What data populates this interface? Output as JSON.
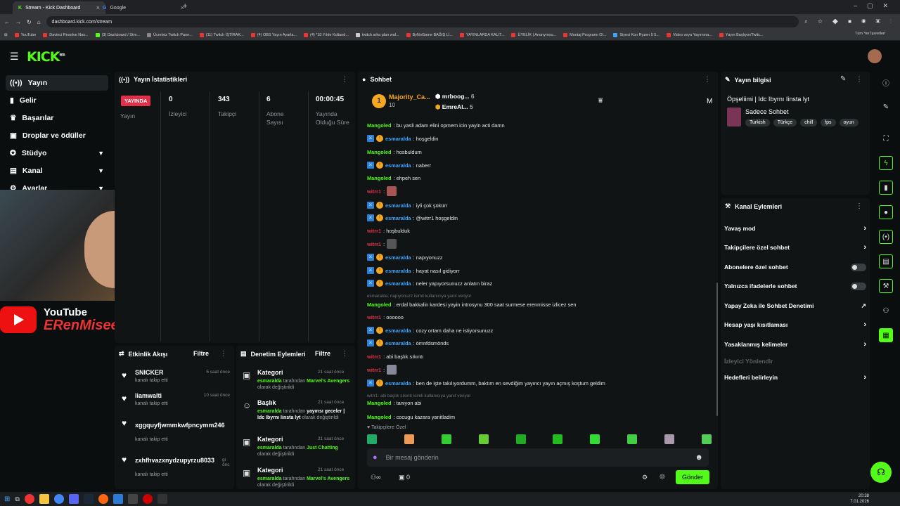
{
  "browser": {
    "tabs": [
      {
        "title": "Stream - Kick Dashboard",
        "active": true
      },
      {
        "title": "Google",
        "active": false
      }
    ],
    "url": "dashboard.kick.com/stream",
    "bookmarks": [
      "YouTube",
      "Davinci Resolve Nas...",
      "(3) Dashboard / Stre...",
      "Ücretsiz Twitch Pane...",
      "(11) Twitch İŞTİRAK...",
      "(4) OBS Yayın Ayarla...",
      "(4) *10 Yılde Kulland...",
      "twitch arka plan wal...",
      "ByNoGame BAĞIŞ Lİ...",
      "YAYINLARDA KALIT...",
      "ÜYELİK | Anonymou...",
      "Montaj Programı Ol...",
      "Siyesi Kısı Ryzen 5 5...",
      "Video veya Yayımına...",
      "Yayın Başlıyor/Twitc..."
    ],
    "all_bookmarks": "Tüm Yer İşaretleri"
  },
  "sidebar": {
    "items": [
      {
        "label": "Yayın",
        "icon": "broadcast-icon",
        "active": true
      },
      {
        "label": "Gelir",
        "icon": "revenue-icon"
      },
      {
        "label": "Başarılar",
        "icon": "trophy-icon"
      },
      {
        "label": "Droplar ve ödüller",
        "icon": "gift-icon"
      },
      {
        "label": "Stüdyo",
        "icon": "studio-icon",
        "expandable": true
      },
      {
        "label": "Kanal",
        "icon": "channel-icon",
        "expandable": true
      },
      {
        "label": "Ayarlar",
        "icon": "gear-icon",
        "expandable": true
      }
    ]
  },
  "webcam_overlay": {
    "brand": "YouTube",
    "channel": "ERenMisee"
  },
  "stats": {
    "title": "Yayın İstatistikleri",
    "live_badge": "YAYINDA",
    "stream_label": "Yayın",
    "viewers": {
      "value": "0",
      "label": "İzleyici"
    },
    "followers": {
      "value": "343",
      "label": "Takipçi"
    },
    "subs": {
      "value": "6",
      "label": "Abone Sayısı"
    },
    "duration": {
      "value": "00:00:45",
      "label": "Yayında Olduğu Süre"
    }
  },
  "activity": {
    "title": "Etkinlik Akışı",
    "filter": "Filtre",
    "items": [
      {
        "name": "SNICKER",
        "sub": "kanalı takip etti",
        "time": "5 saat önce"
      },
      {
        "name": "liamwalti",
        "sub": "kanalı takip etti",
        "time": "10 saat önce"
      },
      {
        "name": "xggquyfjwmmkwfpncymm246",
        "sub": "kanalı takip etti",
        "time": ""
      },
      {
        "name": "zxhfhvazxnydzupyrzu8033",
        "sub": "kanalı takip etti",
        "time": "gi önc"
      }
    ]
  },
  "moderation": {
    "title": "Denetim Eylemleri",
    "filter": "Filtre",
    "items": [
      {
        "title": "Kategori",
        "time": "21 saat önce",
        "user": "esmaralda",
        "mid": " tarafından ",
        "value": "Marvel's Avengers",
        "tail": " olarak değiştirildi"
      },
      {
        "title": "Başlık",
        "time": "21 saat önce",
        "user": "esmaralda",
        "mid": " tarafından ",
        "value_plain": "yayınsı geceler | Idc Ibyrnı Iinsta lyt",
        "tail": " olarak değiştirildi"
      },
      {
        "title": "Kategori",
        "time": "21 saat önce",
        "user": "esmaralda",
        "mid": " tarafından ",
        "value": "Just Chatting",
        "tail": " olarak değiştirildi"
      },
      {
        "title": "Kategori",
        "time": "21 saat önce",
        "user": "esmaralda",
        "mid": " tarafından ",
        "value": "Marvel's Avengers",
        "tail": " olarak değiştirildi"
      }
    ]
  },
  "chat": {
    "title": "Sohbet",
    "top_gifters": [
      {
        "name": "Majority_Ca...",
        "count": "10"
      },
      {
        "name": "mrboog...",
        "count": "6"
      },
      {
        "name": "EmreAl...",
        "count": "5"
      }
    ],
    "messages": [
      {
        "user": "Mangoled",
        "color": "g",
        "text": ": bu yasli adam elini opmem icin yayin acti damn"
      },
      {
        "user": "esmaralda",
        "color": "b",
        "badges": true,
        "text": ": hoşgeldin"
      },
      {
        "user": "Mangoled",
        "color": "g",
        "text": ": hosbuldum"
      },
      {
        "user": "esmaralda",
        "color": "b",
        "badges": true,
        "text": ": naberr"
      },
      {
        "user": "Mangoled",
        "color": "g",
        "text": ": ehpeh sen"
      },
      {
        "user": "witrr1",
        "color": "r",
        "text": ":",
        "emote": true
      },
      {
        "user": "esmaralda",
        "color": "b",
        "badges": true,
        "text": ": iyli çok şükürr"
      },
      {
        "user": "esmaralda",
        "color": "b",
        "badges": true,
        "text": ": @witrr1 hoşgeldin"
      },
      {
        "user": "witrr1",
        "color": "r",
        "text": ": hoşbulduk"
      },
      {
        "user": "witrr1",
        "color": "r",
        "text": ":",
        "emote": true
      },
      {
        "user": "esmaralda",
        "color": "b",
        "badges": true,
        "text": ": napıyonuzz"
      },
      {
        "user": "esmaralda",
        "color": "b",
        "badges": true,
        "text": ": hayat nasıl gidiyorr"
      },
      {
        "user": "esmaralda",
        "color": "b",
        "badges": true,
        "text": ": neler yapıyorsunuzz anlatın biraz"
      },
      {
        "reply": "esmaralda: napıyonuzz isimli kullanıcıya yanıt veriyor"
      },
      {
        "user": "Mangoled",
        "color": "g",
        "text": ": erdal bakkalin kardesi yayin introsynu 300 saat surmese erenmisse izlicez sen"
      },
      {
        "user": "witrr1",
        "color": "r",
        "text": ": oooooo"
      },
      {
        "user": "esmaralda",
        "color": "b",
        "badges": true,
        "text": ": cozy ortam daha ne istiyorsunuzz"
      },
      {
        "user": "esmaralda",
        "color": "b",
        "badges": true,
        "text": ": ömnfdsmönds"
      },
      {
        "user": "witrr1",
        "color": "r",
        "text": ": abi başlık sıkıntı"
      },
      {
        "user": "witrr1",
        "color": "r",
        "text": ":",
        "emote": true
      },
      {
        "user": "esmaralda",
        "color": "b",
        "badges": true,
        "text": ": ben de işte takılıyordumm, baktım en sevdiğim yayıncı yayın açmış koştum geldim"
      },
      {
        "reply": "witrr1: abi başlık sıkıntı isimli kullanıcıya yanıt veriyor"
      },
      {
        "user": "Mangoled",
        "color": "g",
        "text": ": taniyon abi"
      },
      {
        "user": "Mangoled",
        "color": "g",
        "text": ": cocugu kazara yanitladim"
      }
    ],
    "followers_only_label": "Takipçilere Özel",
    "input_placeholder": "Bir mesaj gönderin",
    "viewer_count": "0",
    "send_label": "Gönder"
  },
  "stream_info": {
    "title": "Yayın bilgisi",
    "stream_title": "Öpşeliimi | Idc Ibyrnı Iinsta lyt",
    "category": "Sadece Sohbet",
    "tags": [
      "Turkish",
      "Türkçe",
      "chill",
      "fps",
      "oyun"
    ]
  },
  "channel_actions": {
    "title": "Kanal Eylemleri",
    "items": [
      {
        "label": "Yavaş mod",
        "type": "arrow"
      },
      {
        "label": "Takipçilere özel sohbet",
        "type": "arrow"
      },
      {
        "label": "Abonelere özel sohbet",
        "type": "toggle"
      },
      {
        "label": "Yalnızca ifadelerle sohbet",
        "type": "toggle"
      },
      {
        "label": "Yapay Zeka ile Sohbet Denetimi",
        "type": "external"
      },
      {
        "label": "Hesap yaşı kısıtlaması",
        "type": "arrow"
      },
      {
        "label": "Yasaklanmış kelimeler",
        "type": "arrow"
      },
      {
        "label": "İzleyici Yönlendir",
        "type": "disabled"
      },
      {
        "label": "Hedefleri belirleyin",
        "type": "arrow"
      }
    ]
  },
  "taskbar": {
    "time": "20:38",
    "date": "7.01.2026"
  },
  "colors": {
    "accent": "#53fc18",
    "live": "#e0304a",
    "bg": "#0b0e0f",
    "card": "#111415"
  }
}
